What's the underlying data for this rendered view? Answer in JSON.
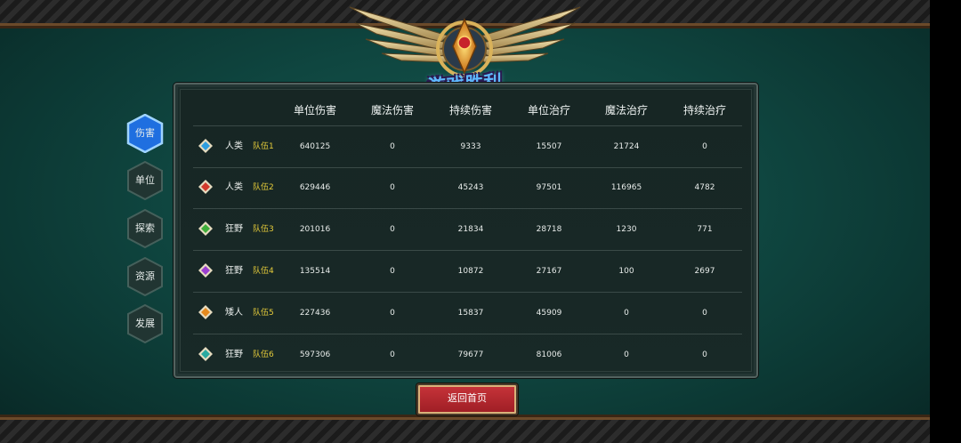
{
  "banner": {
    "title": "游戏胜利"
  },
  "tabs": [
    {
      "label": "伤害",
      "active": true
    },
    {
      "label": "单位",
      "active": false
    },
    {
      "label": "探索",
      "active": false
    },
    {
      "label": "资源",
      "active": false
    },
    {
      "label": "发展",
      "active": false
    }
  ],
  "table": {
    "headers": [
      "单位伤害",
      "魔法伤害",
      "持续伤害",
      "单位治疗",
      "魔法治疗",
      "持续治疗"
    ],
    "rows": [
      {
        "gem_color": "#2f9ee0",
        "race": "人类",
        "team": "队伍1",
        "values": [
          "640125",
          "0",
          "9333",
          "15507",
          "21724",
          "0"
        ]
      },
      {
        "gem_color": "#d23a2c",
        "race": "人类",
        "team": "队伍2",
        "values": [
          "629446",
          "0",
          "45243",
          "97501",
          "116965",
          "4782"
        ]
      },
      {
        "gem_color": "#3fae3a",
        "race": "狂野",
        "team": "队伍3",
        "values": [
          "201016",
          "0",
          "21834",
          "28718",
          "1230",
          "771"
        ]
      },
      {
        "gem_color": "#9b3fd0",
        "race": "狂野",
        "team": "队伍4",
        "values": [
          "135514",
          "0",
          "10872",
          "27167",
          "100",
          "2697"
        ]
      },
      {
        "gem_color": "#e58a1e",
        "race": "矮人",
        "team": "队伍5",
        "values": [
          "227436",
          "0",
          "15837",
          "45909",
          "0",
          "0"
        ]
      },
      {
        "gem_color": "#2aa9a0",
        "race": "狂野",
        "team": "队伍6",
        "values": [
          "597306",
          "0",
          "79677",
          "81006",
          "0",
          "0"
        ]
      }
    ]
  },
  "footer": {
    "home_label": "返回首页"
  }
}
